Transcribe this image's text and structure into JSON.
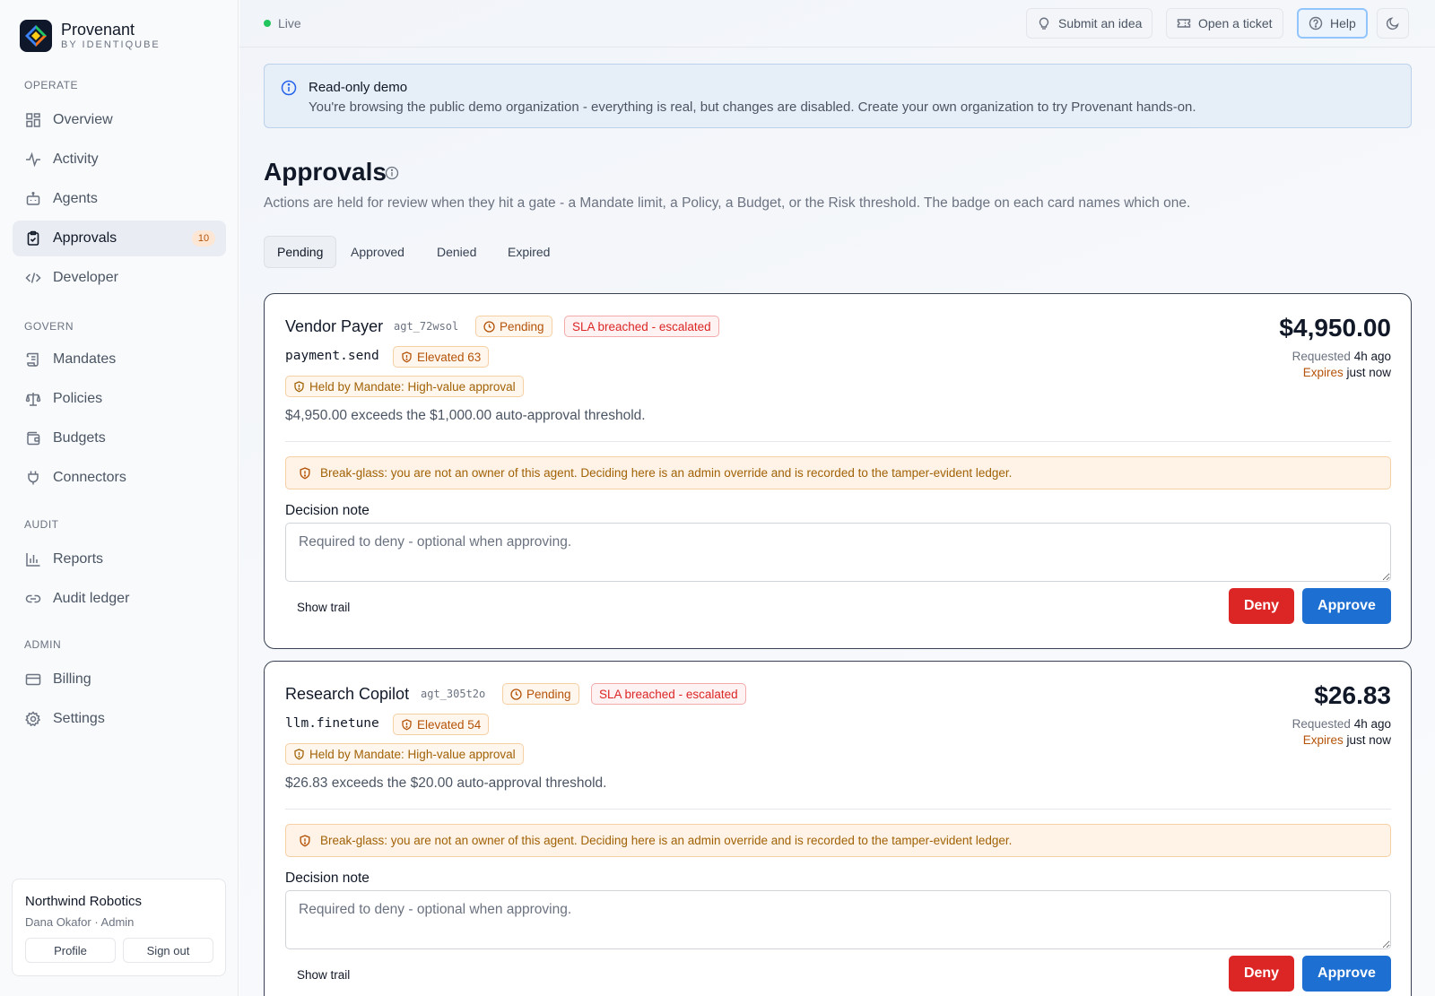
{
  "brand": {
    "name": "Provenant",
    "subtitle": "BY IDENTIQUBE"
  },
  "sidebar": {
    "sections": [
      {
        "label": "OPERATE",
        "items": [
          {
            "label": "Overview",
            "icon": "grid-icon"
          },
          {
            "label": "Activity",
            "icon": "activity-icon"
          },
          {
            "label": "Agents",
            "icon": "bot-icon"
          },
          {
            "label": "Approvals",
            "icon": "clipboard-check-icon",
            "badge": "10",
            "active": true
          },
          {
            "label": "Developer",
            "icon": "code-icon"
          }
        ]
      },
      {
        "label": "GOVERN",
        "items": [
          {
            "label": "Mandates",
            "icon": "scroll-icon"
          },
          {
            "label": "Policies",
            "icon": "scale-icon"
          },
          {
            "label": "Budgets",
            "icon": "wallet-icon"
          },
          {
            "label": "Connectors",
            "icon": "plug-icon"
          }
        ]
      },
      {
        "label": "AUDIT",
        "items": [
          {
            "label": "Reports",
            "icon": "bar-chart-icon"
          },
          {
            "label": "Audit ledger",
            "icon": "link-icon"
          }
        ]
      },
      {
        "label": "ADMIN",
        "items": [
          {
            "label": "Billing",
            "icon": "credit-card-icon"
          },
          {
            "label": "Settings",
            "icon": "gear-icon"
          }
        ]
      }
    ],
    "org": {
      "name": "Northwind Robotics",
      "user": "Dana Okafor · Admin",
      "profile_label": "Profile",
      "signout_label": "Sign out"
    }
  },
  "topbar": {
    "status": "Live",
    "submit_idea": "Submit an idea",
    "open_ticket": "Open a ticket",
    "help": "Help"
  },
  "banner": {
    "title": "Read-only demo",
    "body": "You're browsing the public demo organization - everything is real, but changes are disabled. Create your own organization to try Provenant hands-on."
  },
  "page": {
    "title": "Approvals",
    "description": "Actions are held for review when they hit a gate - a Mandate limit, a Policy, a Budget, or the Risk threshold. The badge on each card names which one."
  },
  "tabs": [
    {
      "label": "Pending",
      "active": true
    },
    {
      "label": "Approved"
    },
    {
      "label": "Denied"
    },
    {
      "label": "Expired"
    }
  ],
  "cards": [
    {
      "agent_name": "Vendor Payer",
      "agent_id": "agt_72wsol",
      "status": "Pending",
      "sla": "SLA breached - escalated",
      "action": "payment.send",
      "risk": "Elevated 63",
      "held_by": "Held by Mandate: High-value approval",
      "reason": "$4,950.00 exceeds the $1,000.00 auto-approval threshold.",
      "amount": "$4,950.00",
      "requested_label": "Requested",
      "requested_value": "4h ago",
      "expires_label": "Expires",
      "expires_value": "just now",
      "warning": "Break-glass: you are not an owner of this agent. Deciding here is an admin override and is recorded to the tamper-evident ledger.",
      "note_label": "Decision note",
      "note_placeholder": "Required to deny - optional when approving.",
      "show_trail": "Show trail",
      "deny": "Deny",
      "approve": "Approve"
    },
    {
      "agent_name": "Research Copilot",
      "agent_id": "agt_305t2o",
      "status": "Pending",
      "sla": "SLA breached - escalated",
      "action": "llm.finetune",
      "risk": "Elevated 54",
      "held_by": "Held by Mandate: High-value approval",
      "reason": "$26.83 exceeds the $20.00 auto-approval threshold.",
      "amount": "$26.83",
      "requested_label": "Requested",
      "requested_value": "4h ago",
      "expires_label": "Expires",
      "expires_value": "just now",
      "warning": "Break-glass: you are not an owner of this agent. Deciding here is an admin override and is recorded to the tamper-evident ledger.",
      "note_label": "Decision note",
      "note_placeholder": "Required to deny - optional when approving.",
      "show_trail": "Show trail",
      "deny": "Deny",
      "approve": "Approve"
    }
  ],
  "colors": {
    "accent": "#1d6fd1",
    "deny": "#dc2626",
    "warning": "#b45309",
    "live": "#22c55e"
  }
}
